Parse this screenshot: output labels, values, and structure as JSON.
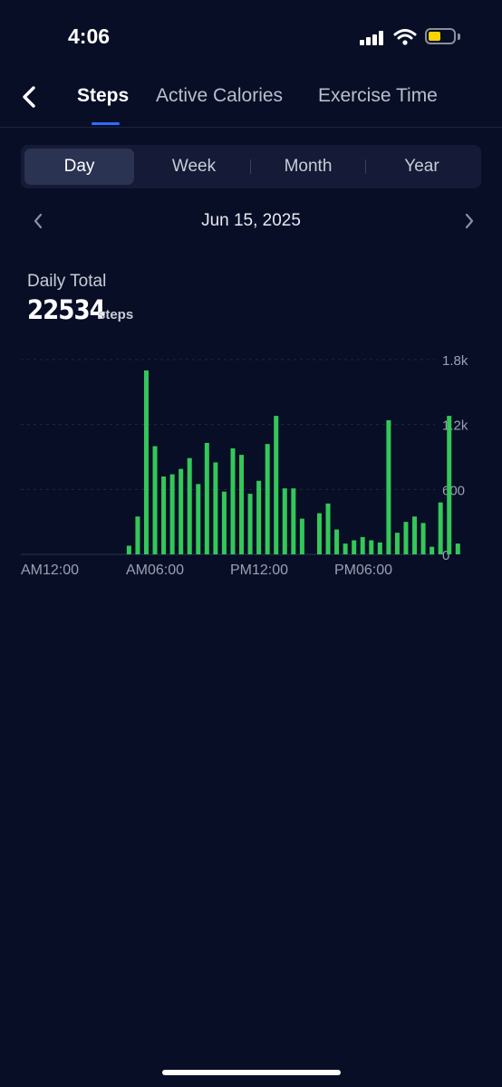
{
  "status": {
    "time": "4:06"
  },
  "nav": {
    "tabs": [
      {
        "label": "Steps",
        "active": true
      },
      {
        "label": "Active Calories",
        "active": false
      },
      {
        "label": "Exercise Time",
        "active": false
      }
    ]
  },
  "segment": {
    "items": [
      "Day",
      "Week",
      "Month",
      "Year"
    ],
    "selected": "Day"
  },
  "date": {
    "label": "Jun 15, 2025"
  },
  "summary": {
    "title": "Daily Total",
    "value": "22534",
    "unit": "steps"
  },
  "colors": {
    "background": "#080e26",
    "bar": "#34c759",
    "accent": "#2f6bff"
  },
  "chart_data": {
    "type": "bar",
    "x_tick_labels": [
      "AM12:00",
      "AM06:00",
      "PM12:00",
      "PM06:00"
    ],
    "y_tick_labels": [
      "1.8k",
      "1.2k",
      "600",
      "0"
    ],
    "ylim": [
      0,
      1800
    ],
    "grid": true,
    "bar_interval_minutes": 30,
    "values": [
      0,
      0,
      0,
      0,
      0,
      0,
      0,
      0,
      0,
      0,
      0,
      0,
      80,
      350,
      1700,
      1000,
      720,
      740,
      790,
      890,
      650,
      1030,
      850,
      580,
      980,
      920,
      560,
      680,
      1020,
      1280,
      610,
      610,
      330,
      0,
      380,
      470,
      230,
      100,
      130,
      160,
      130,
      110,
      1240,
      200,
      300,
      350,
      290,
      70,
      480,
      1280,
      100
    ]
  }
}
